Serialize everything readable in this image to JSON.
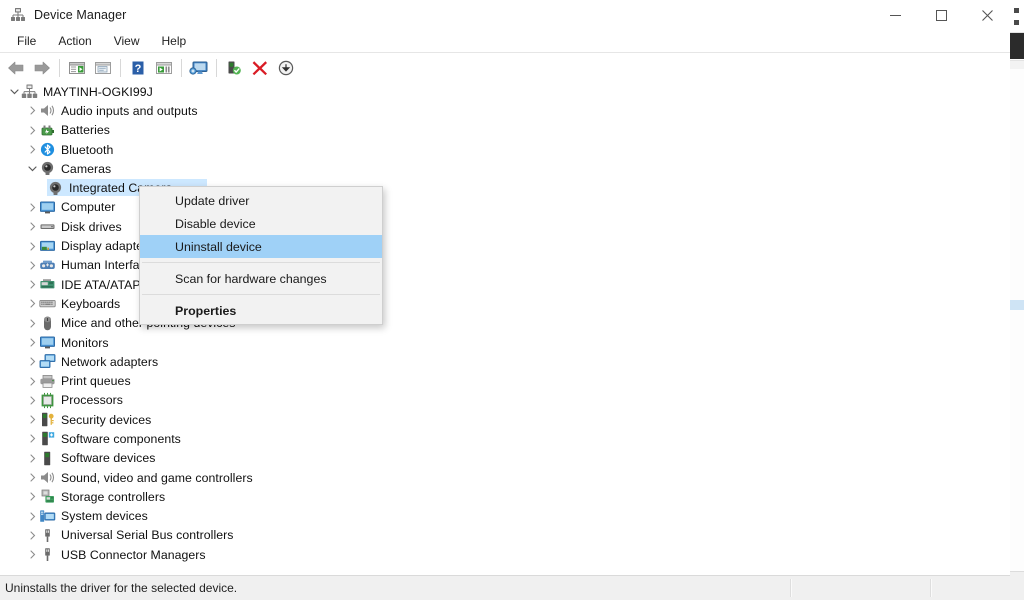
{
  "window": {
    "title": "Device Manager",
    "icon": "device-manager-icon",
    "controls": {
      "minimize": "minimize-icon",
      "maximize": "maximize-icon",
      "close": "close-icon"
    }
  },
  "menubar": {
    "items": [
      {
        "label": "File"
      },
      {
        "label": "Action"
      },
      {
        "label": "View"
      },
      {
        "label": "Help"
      }
    ]
  },
  "toolbar": {
    "buttons": [
      {
        "name": "back-icon",
        "title": "Back"
      },
      {
        "name": "forward-icon",
        "title": "Forward"
      },
      {
        "name": "show-hide-console-tree-icon",
        "title": "Show/Hide Console Tree"
      },
      {
        "name": "properties-icon",
        "title": "Properties"
      },
      {
        "name": "help-icon",
        "title": "Help"
      },
      {
        "name": "update-driver-icon",
        "title": "Update driver"
      },
      {
        "name": "scan-for-hardware-changes-icon",
        "title": "Scan for hardware changes"
      },
      {
        "name": "enable-device-icon",
        "title": "Enable device"
      },
      {
        "name": "uninstall-device-icon",
        "title": "Uninstall device"
      },
      {
        "name": "disable-device-icon",
        "title": "Disable device"
      }
    ]
  },
  "tree": {
    "root": {
      "label": "MAYTINH-OGKI99J",
      "icon": "computer-root-icon",
      "expanded": true
    },
    "nodes": [
      {
        "label": "Audio inputs and outputs",
        "icon": "speaker-icon",
        "level": 1,
        "expanded": false
      },
      {
        "label": "Batteries",
        "icon": "battery-icon",
        "level": 1,
        "expanded": false
      },
      {
        "label": "Bluetooth",
        "icon": "bluetooth-icon",
        "level": 1,
        "expanded": false
      },
      {
        "label": "Cameras",
        "icon": "camera-icon",
        "level": 1,
        "expanded": true
      },
      {
        "label": "Integrated Camera",
        "icon": "camera-icon",
        "level": 2,
        "selected": true
      },
      {
        "label": "Computer",
        "icon": "monitor-icon",
        "level": 1,
        "expanded": false
      },
      {
        "label": "Disk drives",
        "icon": "disk-drive-icon",
        "level": 1,
        "expanded": false
      },
      {
        "label": "Display adapters",
        "icon": "display-adapter-icon",
        "level": 1,
        "expanded": false
      },
      {
        "label": "Human Interface Devices",
        "icon": "hid-icon",
        "level": 1,
        "expanded": false
      },
      {
        "label": "IDE ATA/ATAPI controllers",
        "icon": "ide-controller-icon",
        "level": 1,
        "expanded": false
      },
      {
        "label": "Keyboards",
        "icon": "keyboard-icon",
        "level": 1,
        "expanded": false
      },
      {
        "label": "Mice and other pointing devices",
        "icon": "mouse-icon",
        "level": 1,
        "expanded": false
      },
      {
        "label": "Monitors",
        "icon": "monitor-icon",
        "level": 1,
        "expanded": false
      },
      {
        "label": "Network adapters",
        "icon": "network-adapter-icon",
        "level": 1,
        "expanded": false
      },
      {
        "label": "Print queues",
        "icon": "printer-icon",
        "level": 1,
        "expanded": false
      },
      {
        "label": "Processors",
        "icon": "processor-icon",
        "level": 1,
        "expanded": false
      },
      {
        "label": "Security devices",
        "icon": "security-device-icon",
        "level": 1,
        "expanded": false
      },
      {
        "label": "Software components",
        "icon": "software-component-icon",
        "level": 1,
        "expanded": false
      },
      {
        "label": "Software devices",
        "icon": "software-device-icon",
        "level": 1,
        "expanded": false
      },
      {
        "label": "Sound, video and game controllers",
        "icon": "speaker-icon",
        "level": 1,
        "expanded": false
      },
      {
        "label": "Storage controllers",
        "icon": "storage-controller-icon",
        "level": 1,
        "expanded": false
      },
      {
        "label": "System devices",
        "icon": "system-device-icon",
        "level": 1,
        "expanded": false
      },
      {
        "label": "Universal Serial Bus controllers",
        "icon": "usb-icon",
        "level": 1,
        "expanded": false
      },
      {
        "label": "USB Connector Managers",
        "icon": "usb-icon",
        "level": 1,
        "expanded": false
      }
    ]
  },
  "context_menu": {
    "items": [
      {
        "label": "Update driver",
        "type": "item"
      },
      {
        "label": "Disable device",
        "type": "item"
      },
      {
        "label": "Uninstall device",
        "type": "item",
        "highlighted": true
      },
      {
        "type": "separator"
      },
      {
        "label": "Scan for hardware changes",
        "type": "item"
      },
      {
        "type": "separator"
      },
      {
        "label": "Properties",
        "type": "item",
        "bold": true
      }
    ]
  },
  "statusbar": {
    "text": "Uninstalls the driver for the selected device."
  },
  "colors": {
    "selection_blue": "#cde8ff",
    "menu_highlight": "#9fd1f7",
    "close_hover": "#e81123",
    "window_bg": "#ffffff",
    "statusbar_bg": "#f0f0f0"
  }
}
